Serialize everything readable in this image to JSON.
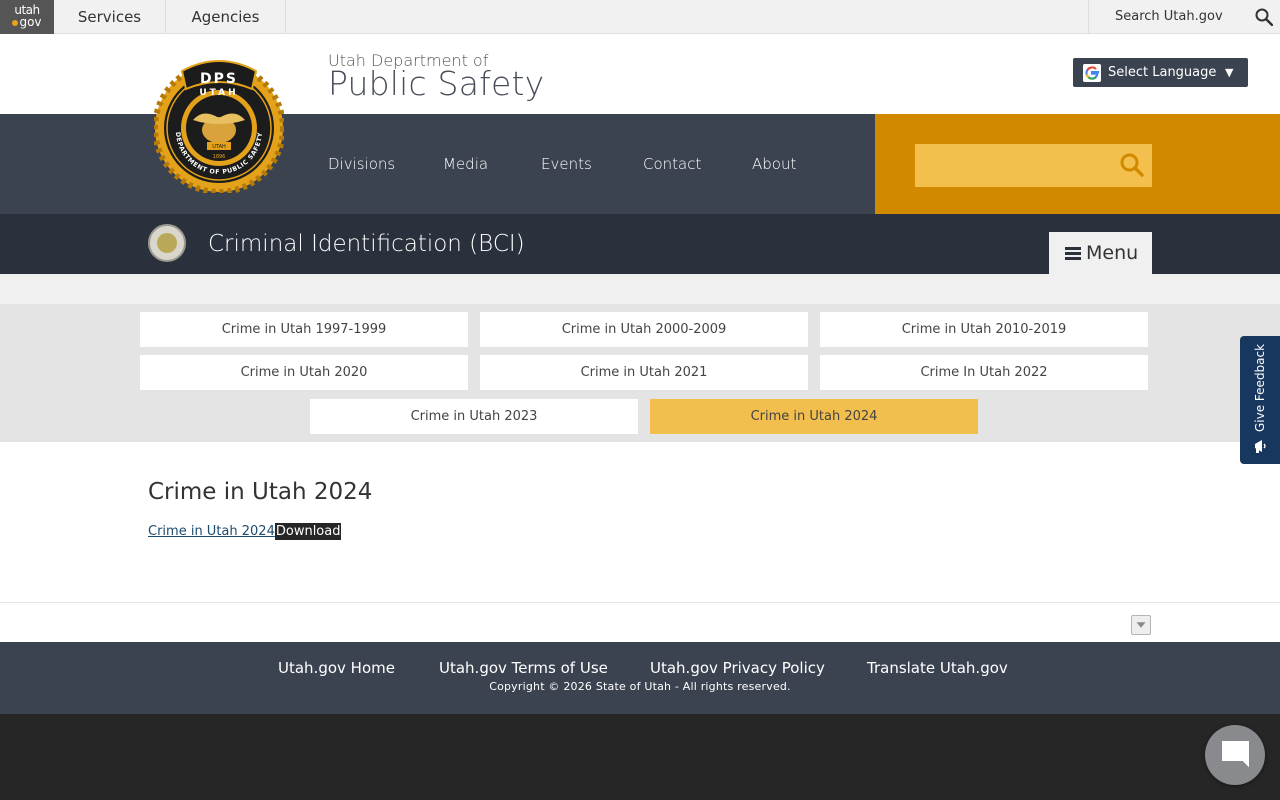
{
  "utah_bar": {
    "logo_top": "utah",
    "logo_bottom": "gov",
    "services": "Services",
    "agencies": "Agencies",
    "search_label": "Search Utah.gov"
  },
  "header": {
    "agency_sub": "Utah Department of",
    "agency_main": "Public Safety",
    "language_button": "Select Language",
    "language_arrow": "▼"
  },
  "seal": {
    "top_text": "DPS",
    "ring_text": "UTAH",
    "outer_text": "DEPARTMENT OF PUBLIC SAFETY",
    "center_text": "UTAH",
    "year": "1896"
  },
  "nav": {
    "items": [
      "Divisions",
      "Media",
      "Events",
      "Contact",
      "About"
    ]
  },
  "division": {
    "title": "Criminal Identification (BCI)",
    "menu_label": "Menu"
  },
  "tiles": [
    {
      "label": "Crime in Utah 1997-1999",
      "active": false
    },
    {
      "label": "Crime in Utah 2000-2009",
      "active": false
    },
    {
      "label": "Crime in Utah 2010-2019",
      "active": false
    },
    {
      "label": "Crime in Utah 2020",
      "active": false
    },
    {
      "label": "Crime in Utah 2021",
      "active": false
    },
    {
      "label": "Crime In Utah 2022",
      "active": false
    },
    {
      "label": "Crime in Utah 2023",
      "active": false
    },
    {
      "label": "Crime in Utah 2024",
      "active": true
    }
  ],
  "main": {
    "title": "Crime in Utah 2024",
    "link_text": "Crime in Utah 2024",
    "download_label": "Download"
  },
  "footer": {
    "links": [
      "Utah.gov Home",
      "Utah.gov Terms of Use",
      "Utah.gov Privacy Policy",
      "Translate Utah.gov"
    ],
    "copyright": "Copyright © 2026 State of Utah - All rights reserved."
  },
  "feedback": {
    "label": "Give Feedback"
  },
  "colors": {
    "nav_dark": "#3c4350",
    "division_dark": "#2b313c",
    "accent_orange": "#d18a00",
    "accent_gold": "#f2be4d",
    "feedback_blue": "#17375e"
  }
}
